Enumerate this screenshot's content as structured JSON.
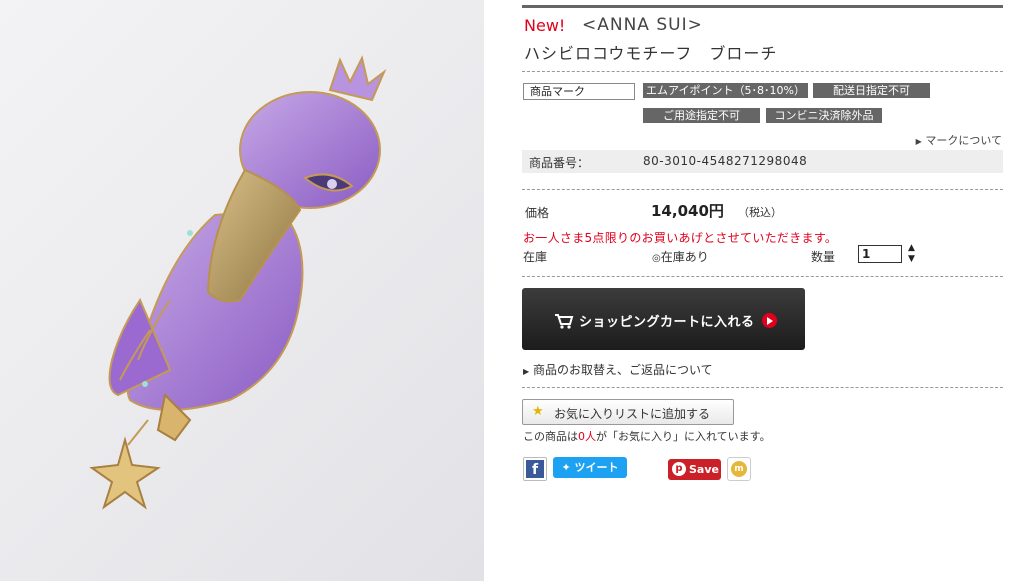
{
  "product": {
    "new_label": "New!",
    "brand": "<ANNA SUI>",
    "name": "ハシビロコウモチーフ　ブローチ",
    "image_alt_icon": "brooch-photo"
  },
  "marks": {
    "label": "商品マーク",
    "badges": [
      "エムアイポイント（5･8･10%）",
      "配送日指定不可",
      "ご用途指定不可",
      "コンビニ決済除外品"
    ],
    "about_link": "マークについて"
  },
  "item_number": {
    "label": "商品番号：",
    "value": "80-3010-4548271298048"
  },
  "price": {
    "label": "価格",
    "value": "14,040円",
    "tax": "（税込）",
    "limit_notice": "お一人さま5点限りのお買いあげとさせていただきます。"
  },
  "stock": {
    "label": "在庫",
    "status": "在庫あり",
    "status_icon": "◎"
  },
  "quantity": {
    "label": "数量",
    "value": "1"
  },
  "cart": {
    "button_label": "ショッピングカートに入れる"
  },
  "links": {
    "returns": "商品のお取替え、ご返品について"
  },
  "favorites": {
    "button_label": "お気に入りリストに追加する",
    "note_prefix": "この商品は",
    "count": "0人",
    "note_suffix": "が「お気に入り」に入れています。"
  },
  "social": {
    "facebook_icon": "f",
    "tweet_label": "ツイート",
    "pinterest_label": "Save"
  },
  "colors": {
    "new_red": "#e0001b",
    "badge_gray": "#666666",
    "cart_button": "#2a2a2a",
    "twitter_blue": "#1da1f2",
    "pinterest_red": "#cb2027"
  }
}
